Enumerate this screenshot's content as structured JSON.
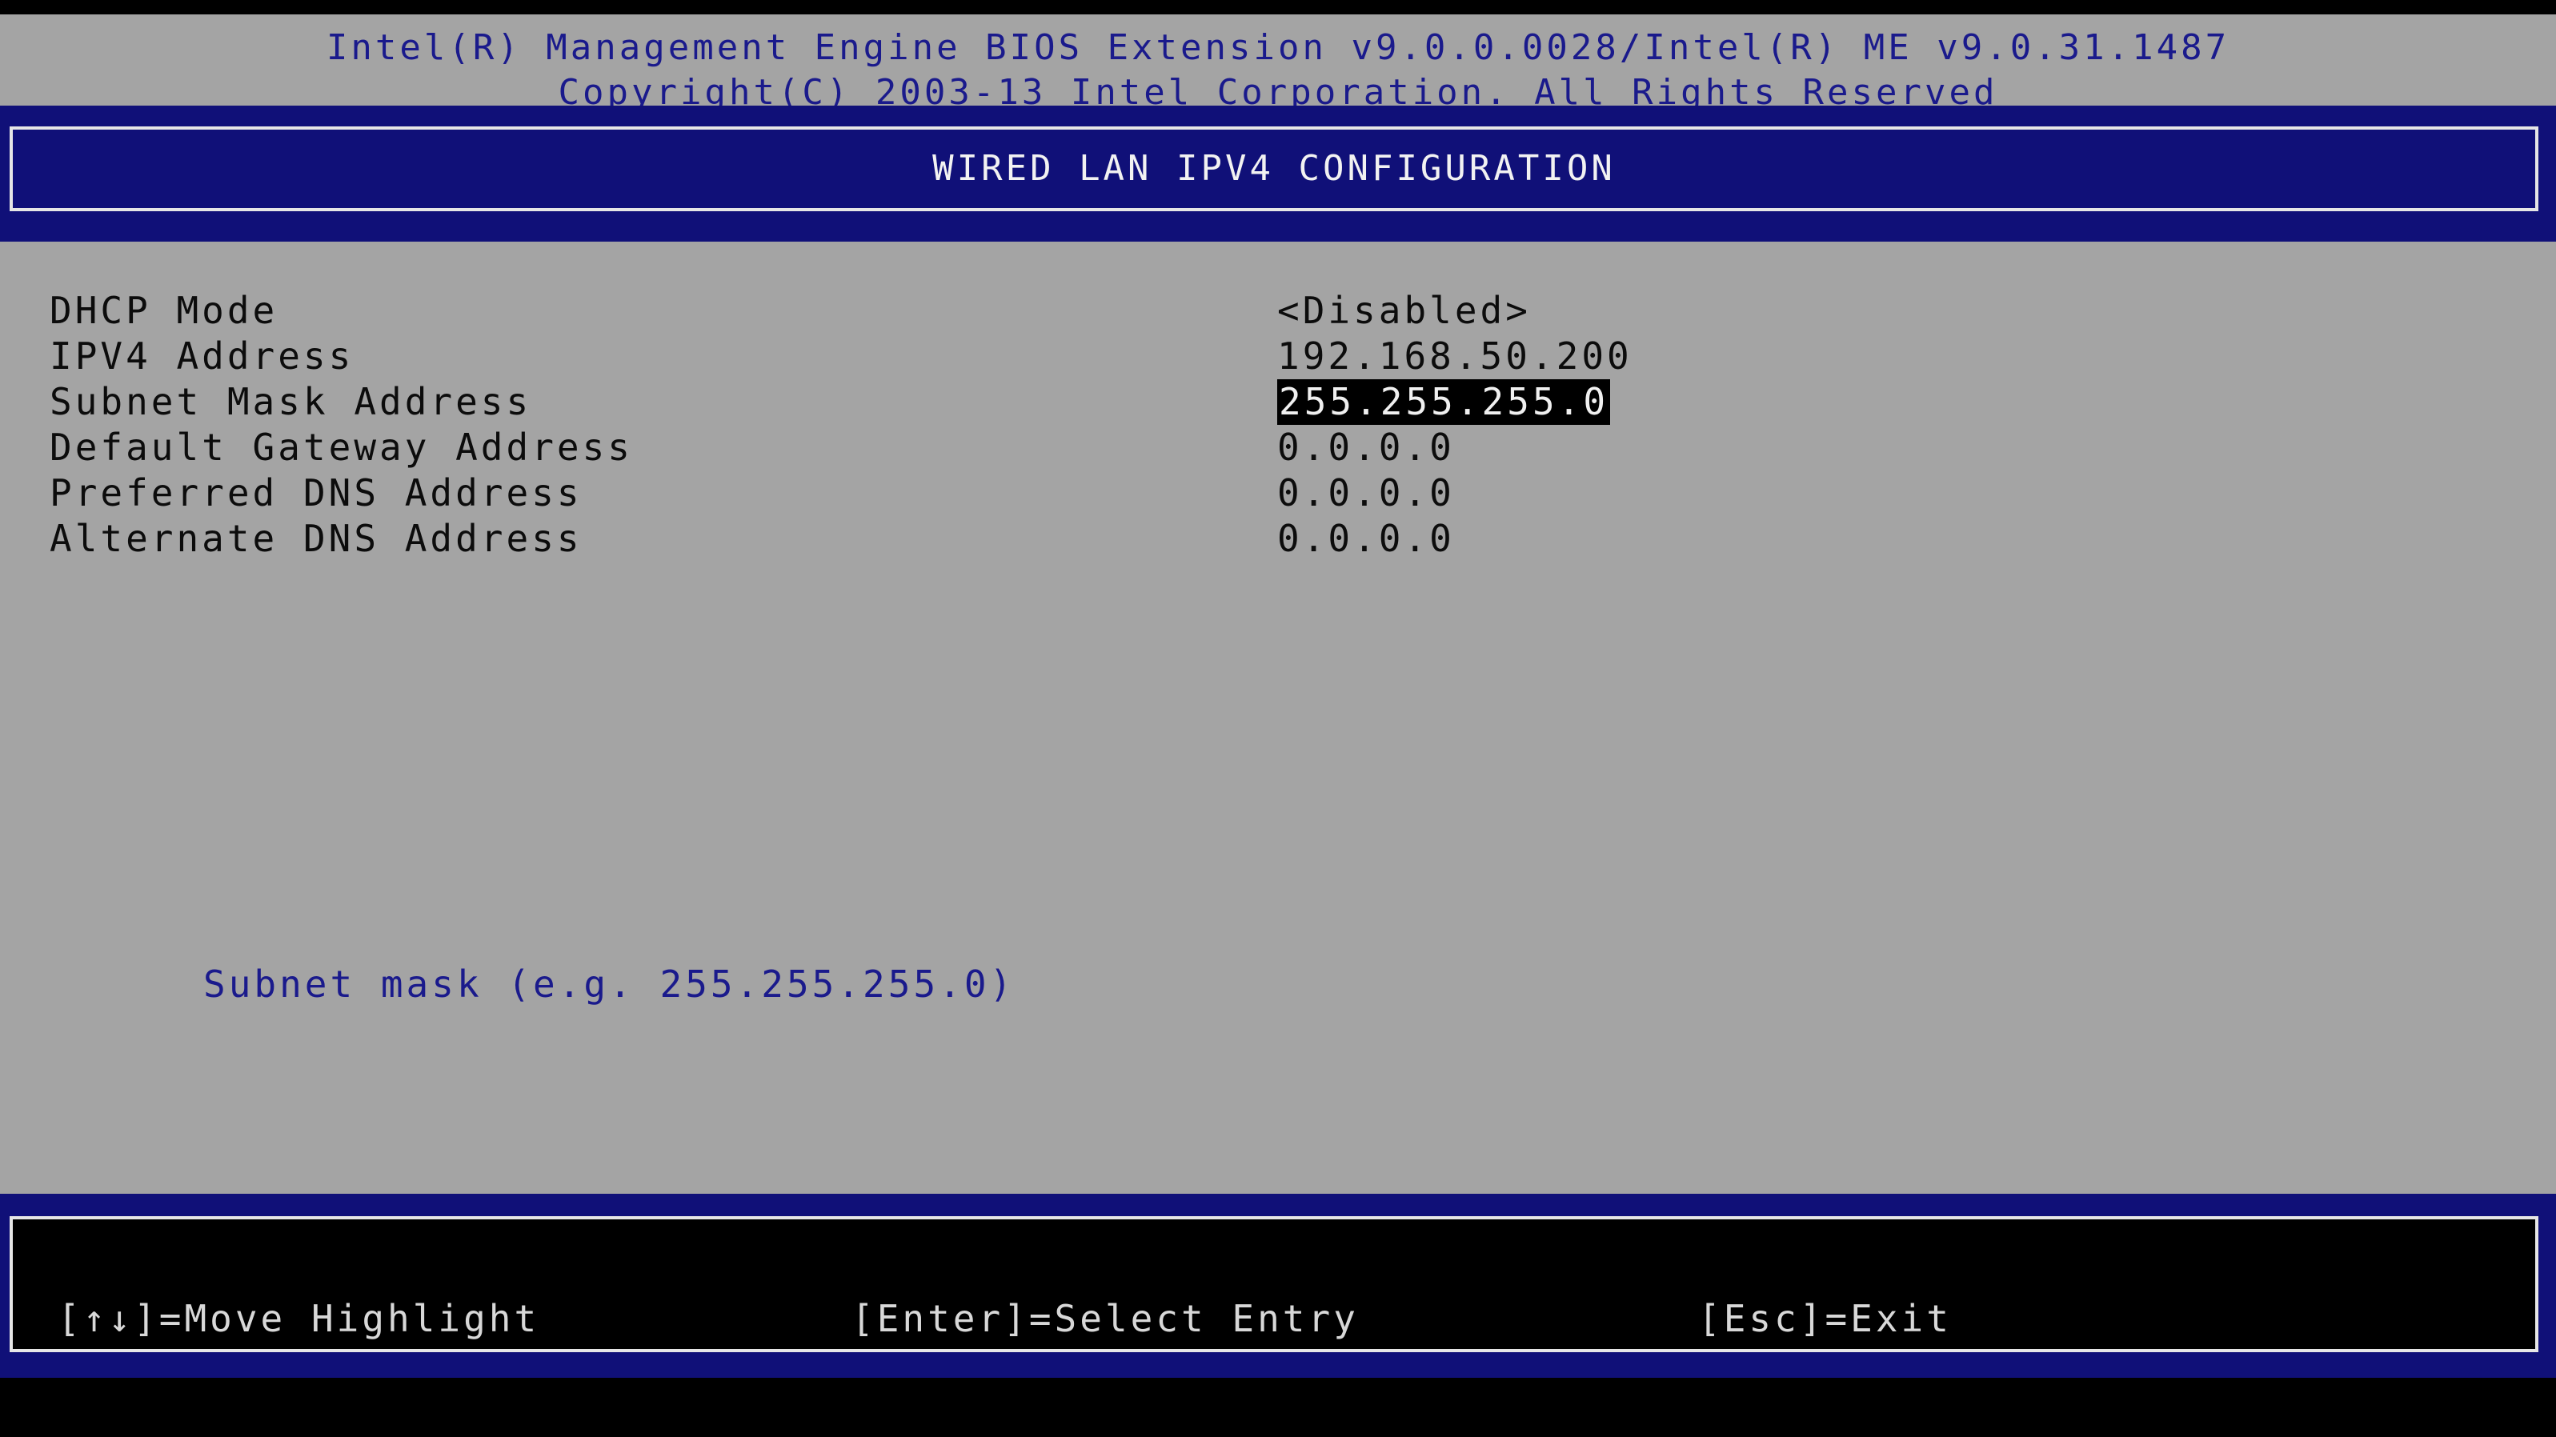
{
  "header": {
    "line1": "Intel(R) Management Engine BIOS Extension v9.0.0.0028/Intel(R) ME v9.0.31.1487",
    "line2": "Copyright(C) 2003-13 Intel Corporation. All Rights Reserved"
  },
  "title": "WIRED LAN IPV4 CONFIGURATION",
  "settings": [
    {
      "label": "DHCP Mode",
      "value": "<Disabled>"
    },
    {
      "label": "IPV4 Address",
      "value": "192.168.50.200"
    },
    {
      "label": "Subnet Mask Address",
      "value": "255.255.255.0",
      "selected": true
    },
    {
      "label": "Default Gateway Address",
      "value": "0.0.0.0"
    },
    {
      "label": "Preferred DNS Address",
      "value": "0.0.0.0"
    },
    {
      "label": "Alternate DNS Address",
      "value": "0.0.0.0"
    }
  ],
  "help_text": "Subnet mask (e.g. 255.255.255.0)",
  "footer": {
    "move": "[↑↓]=Move Highlight",
    "select": "[Enter]=Select Entry",
    "exit": "[Esc]=Exit"
  },
  "colors": {
    "background": "#a4a4a4",
    "band": "#101078",
    "header_text": "#1a1a8c",
    "highlight": "#000000"
  }
}
